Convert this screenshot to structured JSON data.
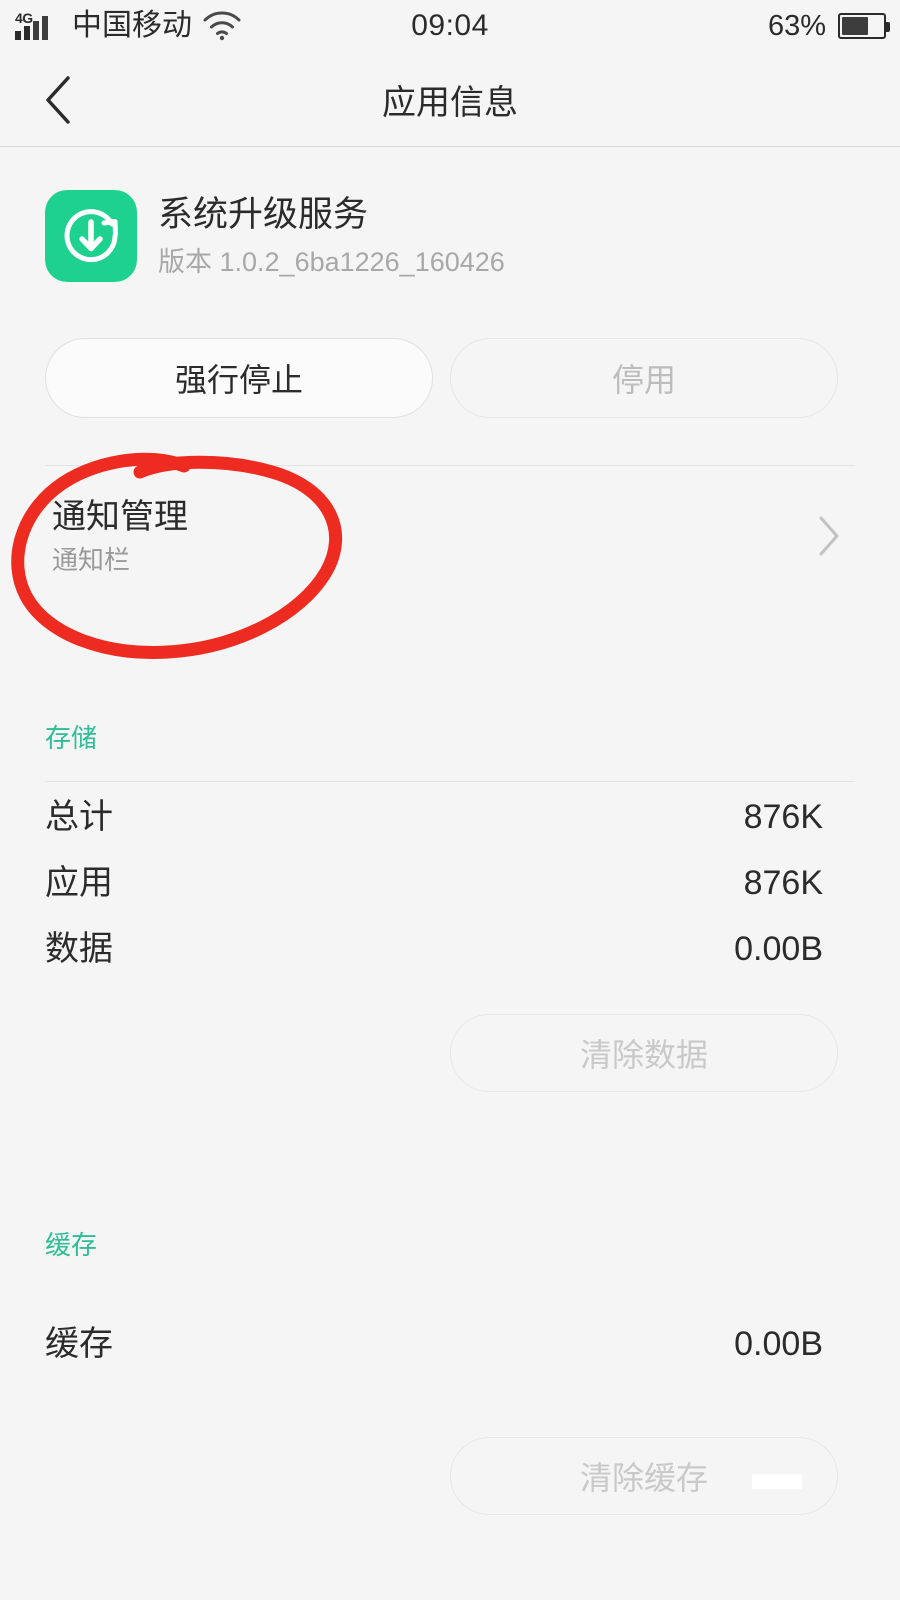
{
  "status_bar": {
    "network_type": "4G",
    "carrier": "中国移动",
    "wifi_icon": "wifi-icon",
    "clock": "09:04",
    "battery_percent": "63%",
    "battery_level": 63,
    "signal_bars": 4
  },
  "nav": {
    "back_icon": "chevron-left-icon",
    "title": "应用信息"
  },
  "app": {
    "icon_name": "system-update-service-icon",
    "icon_color": "#1ed18e",
    "name": "系统升级服务",
    "version": "版本 1.0.2_6ba1226_160426"
  },
  "actions": {
    "force_stop": "强行停止",
    "disable": "停用"
  },
  "notification": {
    "title": "通知管理",
    "subtitle": "通知栏",
    "chevron_icon": "chevron-right-icon"
  },
  "storage": {
    "section_title": "存储",
    "section_color": "#2ebd96",
    "rows": [
      {
        "label": "总计",
        "value": "876K"
      },
      {
        "label": "应用",
        "value": "876K"
      },
      {
        "label": "数据",
        "value": "0.00B"
      }
    ],
    "clear_button": "清除数据"
  },
  "cache": {
    "section_title": "缓存",
    "section_color": "#2ebd96",
    "rows": [
      {
        "label": "缓存",
        "value": "0.00B"
      }
    ],
    "clear_button": "清除缓存"
  },
  "annotation": {
    "shape": "hand-drawn-ellipse",
    "color": "#ee2b20",
    "target": "通知管理"
  }
}
